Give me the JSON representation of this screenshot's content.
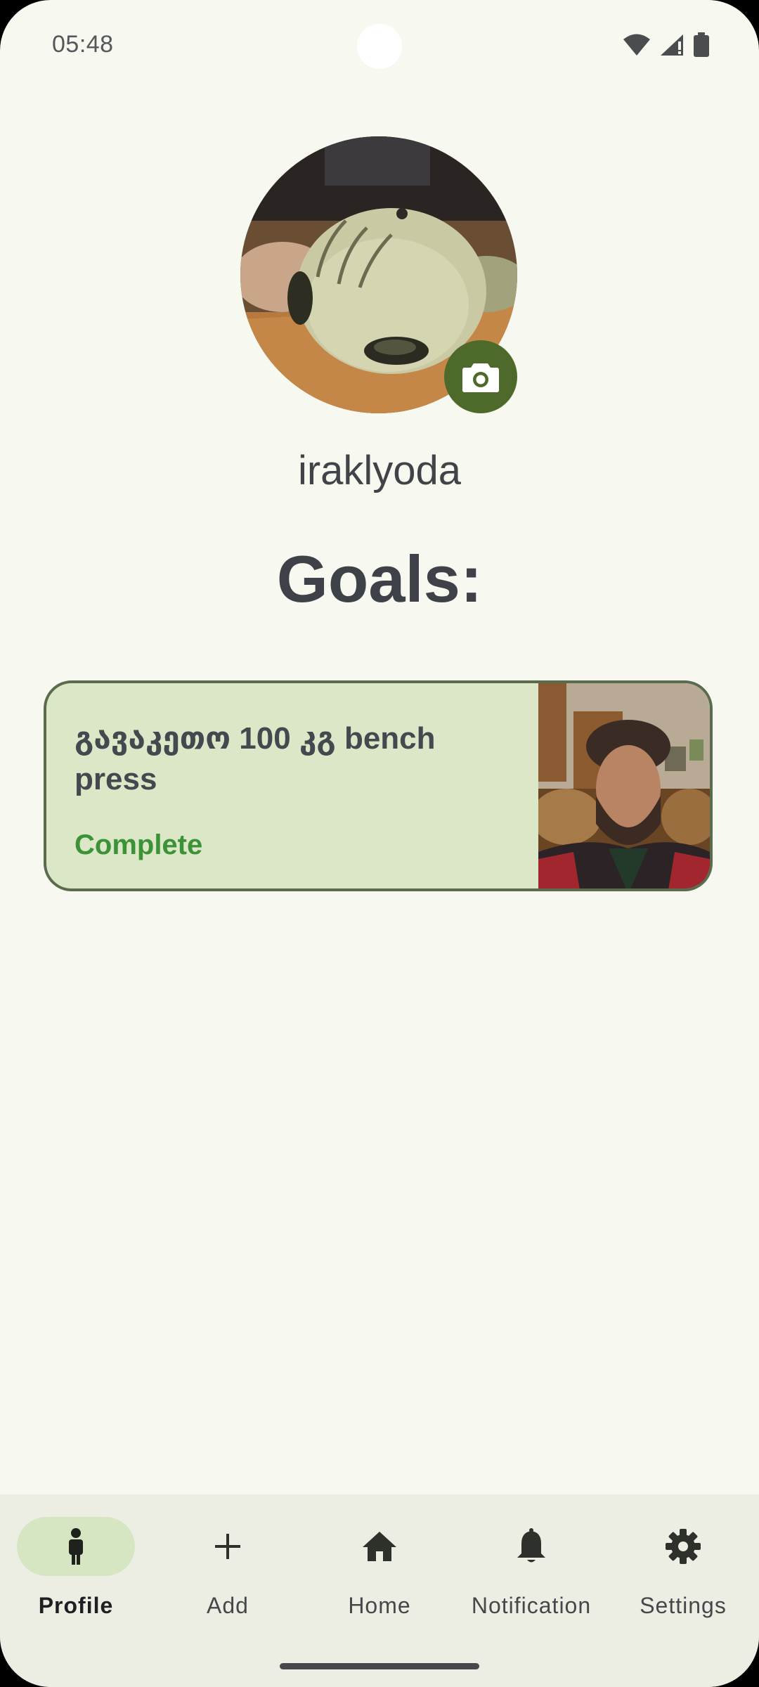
{
  "status_bar": {
    "time": "05:48",
    "icons": [
      "wifi-icon",
      "cell-signal-icon",
      "battery-icon"
    ]
  },
  "profile": {
    "username": "iraklyoda",
    "avatar_icon": "profile-photo",
    "camera_button_icon": "camera-icon"
  },
  "goals": {
    "heading": "Goals:",
    "items": [
      {
        "title": "გავაკეთო 100 კგ bench press",
        "status": "Complete"
      }
    ]
  },
  "nav": {
    "items": [
      {
        "label": "Profile",
        "icon": "person-icon",
        "active": true
      },
      {
        "label": "Add",
        "icon": "plus-icon",
        "active": false
      },
      {
        "label": "Home",
        "icon": "home-icon",
        "active": false
      },
      {
        "label": "Notification",
        "icon": "bell-icon",
        "active": false
      },
      {
        "label": "Settings",
        "icon": "gear-icon",
        "active": false
      }
    ]
  },
  "colors": {
    "background": "#f7f8ef",
    "accent": "#4d6a2b",
    "card_bg": "#dce7c8",
    "status_complete": "#3b9237"
  }
}
